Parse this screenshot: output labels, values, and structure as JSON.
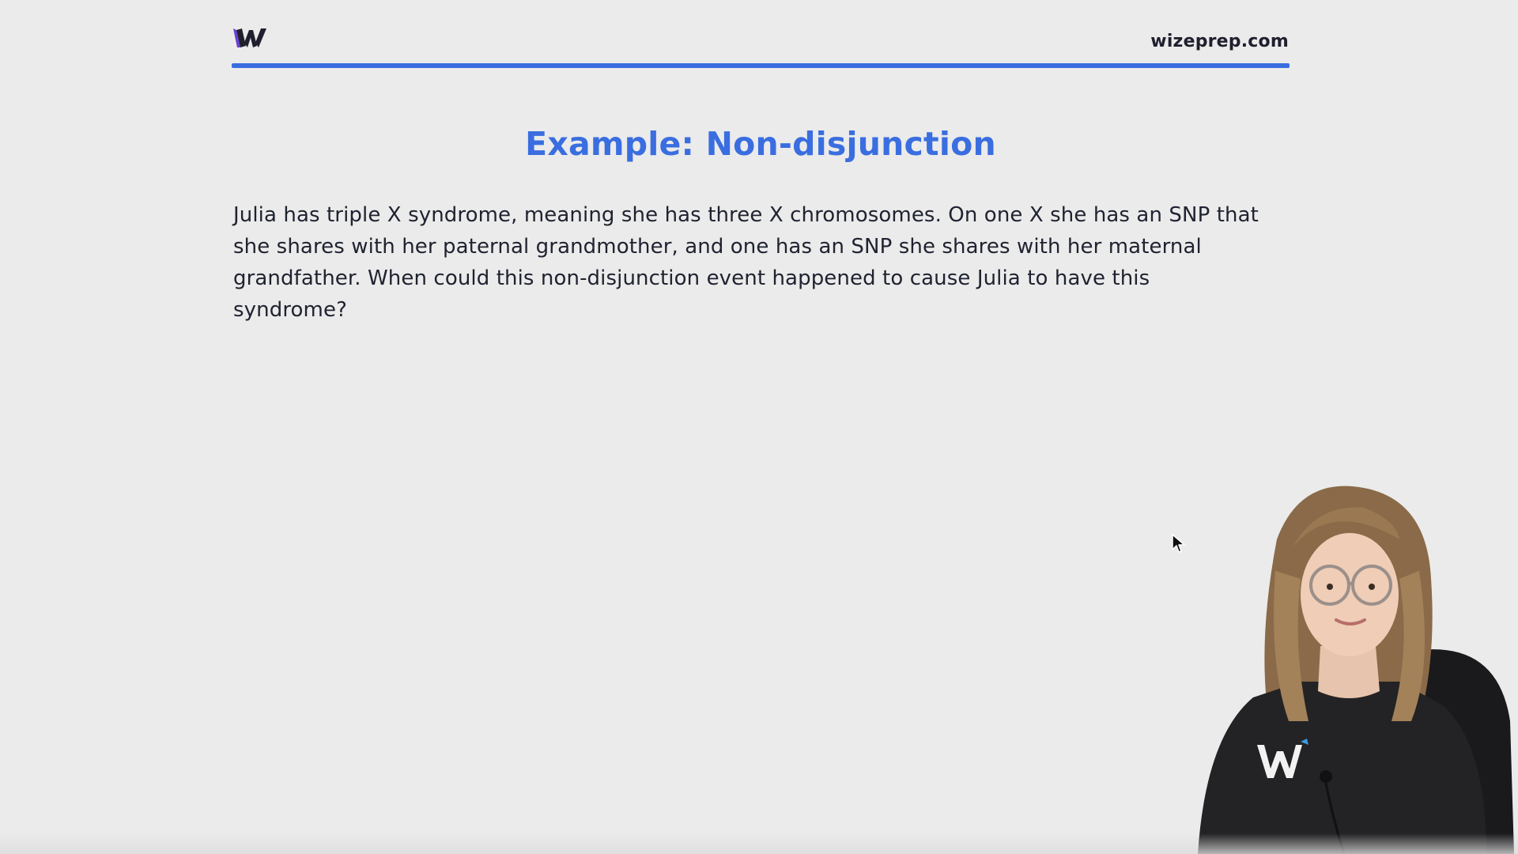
{
  "header": {
    "logo_icon": "wizeprep-logo-icon",
    "site_url": "wizeprep.com",
    "accent_color": "#3a6ee0"
  },
  "slide": {
    "title": "Example: Non-disjunction",
    "question_lines": [
      "Julia has triple X syndrome, meaning she has three X chromosomes. On one X she has an SNP that",
      "she shares with her paternal grandmother, and one has an SNP she shares with her maternal",
      "grandfather. When could this non-disjunction event happened to cause Julia to have this",
      "syndrome?"
    ]
  },
  "overlay": {
    "cursor_icon": "mouse-pointer-icon",
    "presenter": "presenter-video"
  }
}
